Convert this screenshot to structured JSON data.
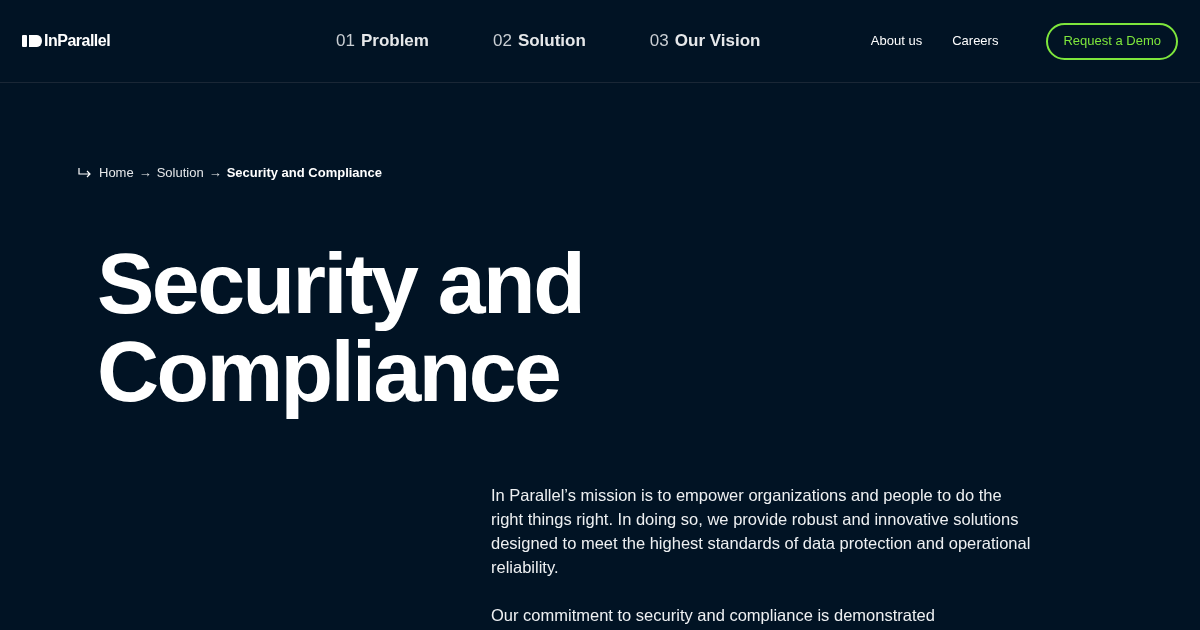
{
  "header": {
    "logo": "InParallel",
    "nav": [
      {
        "number": "01",
        "label": "Problem"
      },
      {
        "number": "02",
        "label": "Solution"
      },
      {
        "number": "03",
        "label": "Our Vision"
      }
    ],
    "links": [
      "About us",
      "Careers"
    ],
    "cta": "Request a Demo"
  },
  "breadcrumb": [
    {
      "kind": "link",
      "text": "Home"
    },
    {
      "kind": "separator",
      "text": "→"
    },
    {
      "kind": "link",
      "text": "Solution"
    },
    {
      "kind": "separator",
      "text": "→"
    },
    {
      "kind": "current",
      "text": "Security and Compliance"
    }
  ],
  "title_lines": [
    "Security and",
    "Compliance"
  ],
  "paragraphs": [
    "In Parallel’s mission is to empower organizations and people to do the right things right. In doing so, we provide robust and innovative solutions designed to meet the highest standards of data protection and operational reliability.",
    "Our commitment to security and compliance is demonstrated"
  ]
}
